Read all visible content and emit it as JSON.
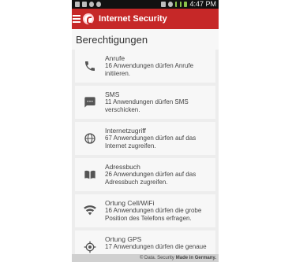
{
  "statusbar": {
    "time": "4:47 PM"
  },
  "appbar": {
    "title": "Internet Security"
  },
  "page": {
    "title": "Berechtigungen"
  },
  "permissions": [
    {
      "icon": "phone-icon",
      "title": "Anrufe",
      "desc": "16 Anwendungen dürfen Anrufe initiieren."
    },
    {
      "icon": "sms-icon",
      "title": "SMS",
      "desc": "11 Anwendungen dürfen SMS verschicken."
    },
    {
      "icon": "globe-icon",
      "title": "Internetzugriff",
      "desc": "67 Anwendungen dürfen auf das Internet zugreifen."
    },
    {
      "icon": "addressbook-icon",
      "title": "Adressbuch",
      "desc": "26 Anwendungen dürfen auf das Adressbuch zugreifen."
    },
    {
      "icon": "wifi-icon",
      "title": "Ortung Cell/WiFi",
      "desc": "16 Anwendungen dürfen die grobe Position des Telefons erfragen."
    },
    {
      "icon": "gps-icon",
      "title": "Ortung GPS",
      "desc": "17 Anwendungen dürfen die genaue"
    }
  ],
  "footer": {
    "brand": "© Data. Security",
    "tagline": "Made in Germany."
  }
}
